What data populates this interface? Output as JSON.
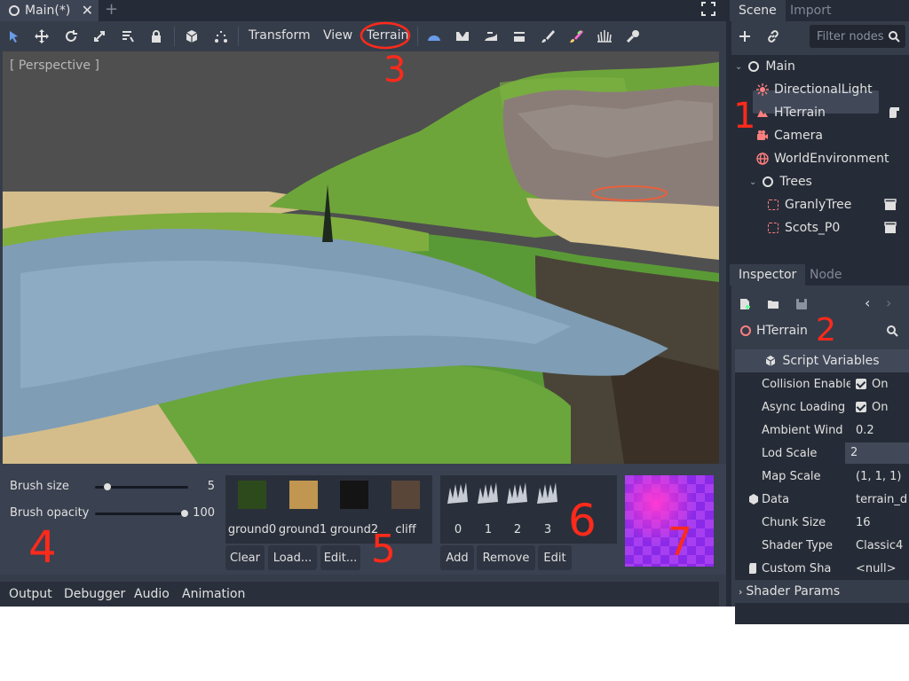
{
  "scene_tab": {
    "title": "Main(*)",
    "close": "✕",
    "add": "+"
  },
  "toolbar": {
    "menus": [
      "Transform",
      "View",
      "Terrain"
    ],
    "tool_icons": [
      "select-icon",
      "move-icon",
      "rotate-icon",
      "scale-icon",
      "list-select-icon",
      "lock-icon",
      "cube-icon",
      "snap-icon"
    ],
    "terrain_icons": [
      "raise-icon",
      "lower-icon",
      "smooth-icon",
      "flatten-icon",
      "paint-icon",
      "color-icon",
      "detail-icon",
      "tool-icon"
    ]
  },
  "viewport": {
    "label": "[ Perspective ]"
  },
  "brush": {
    "size_label": "Brush size",
    "size_value": "5",
    "size_fraction": 0.1,
    "opacity_label": "Brush opacity",
    "opacity_value": "100",
    "opacity_fraction": 1.0
  },
  "textures": {
    "items": [
      {
        "name": "ground0",
        "color": "#2c4a1c"
      },
      {
        "name": "ground1",
        "color": "#c09650"
      },
      {
        "name": "ground2",
        "color": "#141414"
      },
      {
        "name": "cliff",
        "color": "#5a4638"
      }
    ],
    "buttons": [
      "Clear",
      "Load...",
      "Edit..."
    ]
  },
  "details": {
    "items": [
      "0",
      "1",
      "2",
      "3"
    ],
    "buttons": [
      "Add",
      "Remove",
      "Edit"
    ]
  },
  "bottom_tabs": [
    "Output",
    "Debugger",
    "Audio",
    "Animation"
  ],
  "scene_dock": {
    "tabs": [
      "Scene",
      "Import"
    ],
    "filter_placeholder": "Filter nodes",
    "nodes": [
      {
        "name": "Main",
        "icon": "node-icon"
      },
      {
        "name": "DirectionalLight",
        "icon": "light-icon"
      },
      {
        "name": "HTerrain",
        "icon": "terrain-icon"
      },
      {
        "name": "Camera",
        "icon": "camera-icon"
      },
      {
        "name": "WorldEnvironment",
        "icon": "globe-icon"
      },
      {
        "name": "Trees",
        "icon": "node-icon"
      },
      {
        "name": "GranlyTree",
        "icon": "multimesh-icon"
      },
      {
        "name": "Scots_P0",
        "icon": "multimesh-icon"
      }
    ]
  },
  "inspector": {
    "tabs": [
      "Inspector",
      "Node"
    ],
    "object_name": "HTerrain",
    "section": "Script Variables",
    "properties": [
      {
        "name": "Collision Enable",
        "value": "On",
        "checkbox": true
      },
      {
        "name": "Async Loading",
        "value": "On",
        "checkbox": true
      },
      {
        "name": "Ambient Wind",
        "value": "0.2"
      },
      {
        "name": "Lod Scale",
        "value": "2"
      },
      {
        "name": "Map Scale",
        "value": "(1, 1, 1)"
      },
      {
        "name": "Data",
        "value": "terrain_d"
      },
      {
        "name": "Chunk Size",
        "value": "16"
      },
      {
        "name": "Shader Type",
        "value": "Classic4"
      },
      {
        "name": "Custom Sha",
        "value": "<null>"
      }
    ],
    "shader_params": "Shader Params"
  },
  "annotations": [
    "1",
    "2",
    "3",
    "4",
    "5",
    "6",
    "7"
  ],
  "colors": {
    "accent": "#699ce8",
    "annotation": "#ff2a1a",
    "selected": "#414959"
  }
}
